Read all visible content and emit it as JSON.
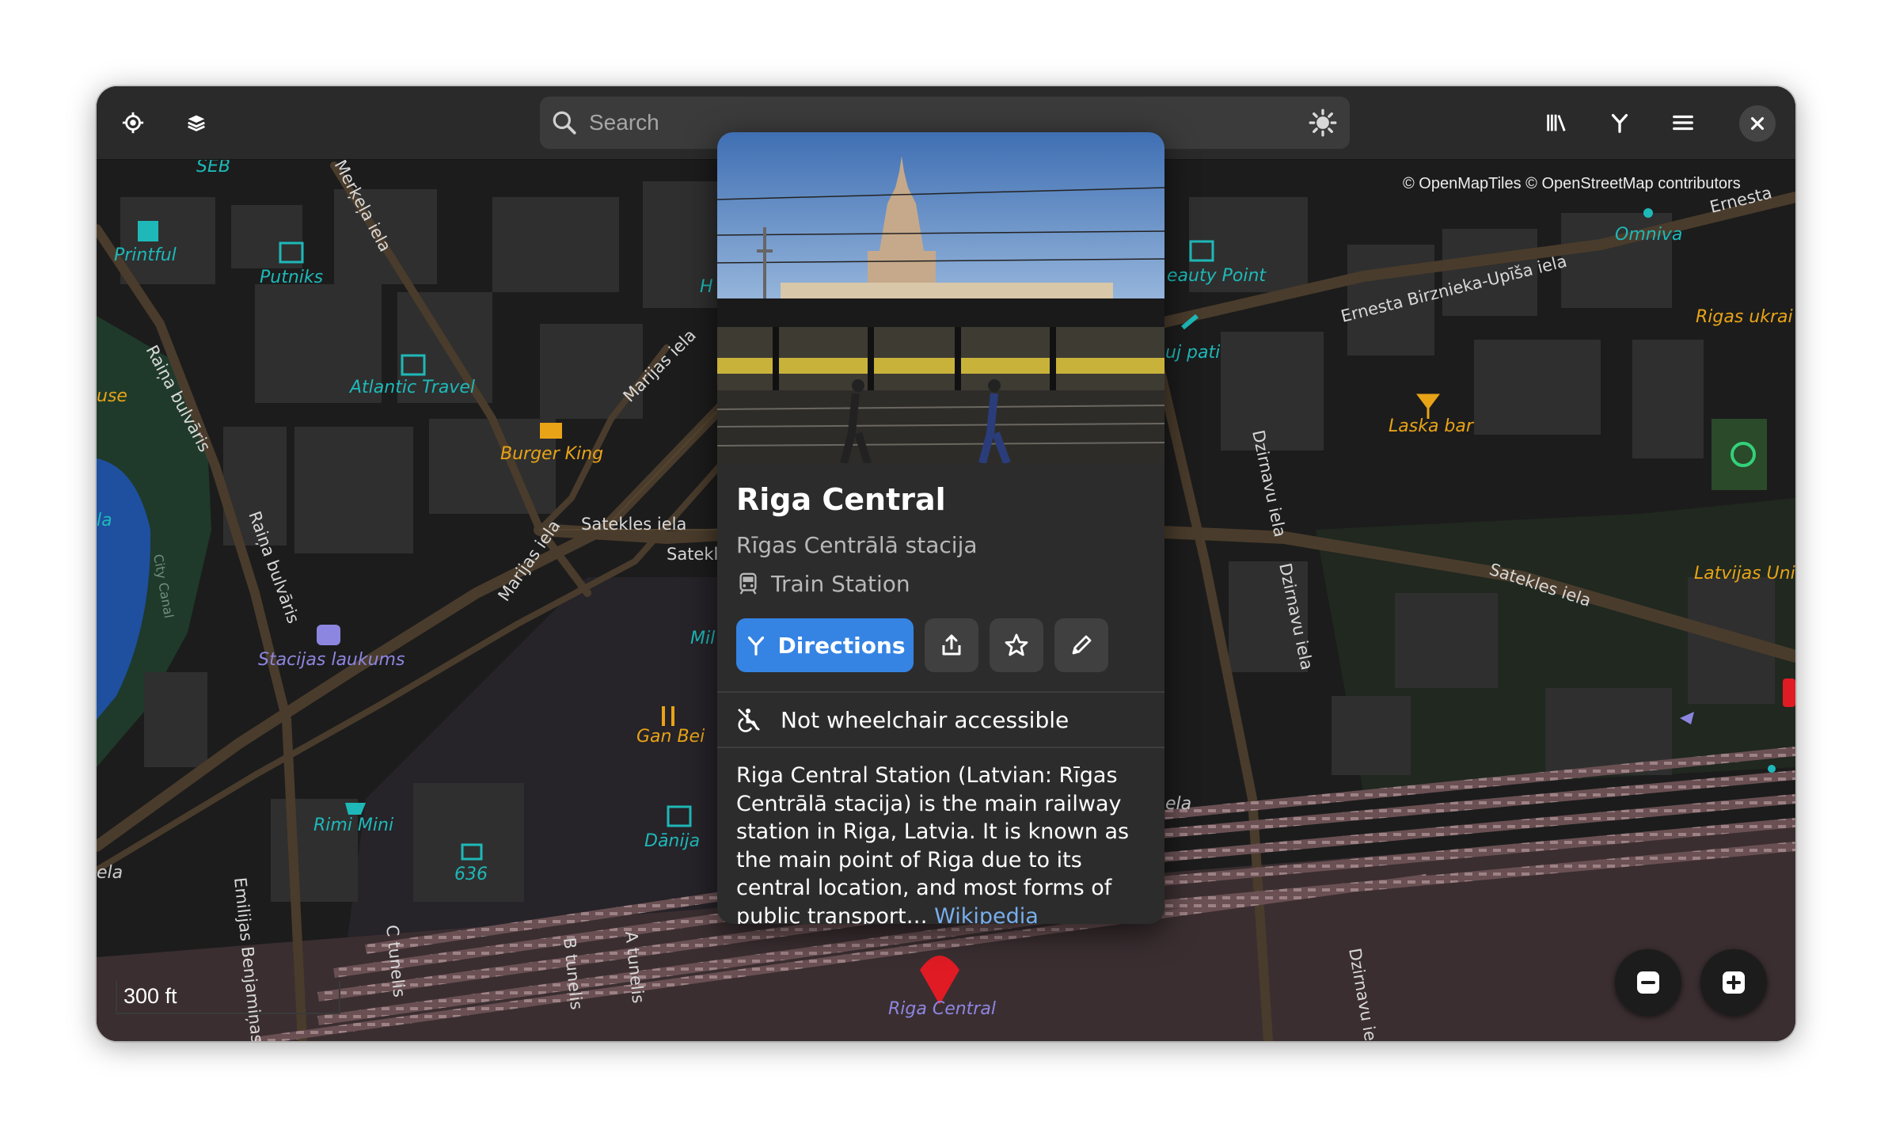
{
  "header": {
    "search_placeholder": "Search",
    "icons": {
      "locate": "crosshair-icon",
      "layers": "layers-icon",
      "search": "search-icon",
      "theme": "sun-icon",
      "library": "library-icon",
      "routing": "route-icon",
      "menu": "hamburger-menu-icon",
      "close": "close-icon"
    }
  },
  "attribution": "© OpenMapTiles © OpenStreetMap contributors",
  "place": {
    "title": "Riga Central",
    "subtitle": "Rīgas Centrālā stacija",
    "type_label": "Train Station",
    "directions_label": "Directions",
    "accessibility": "Not wheelchair accessible",
    "description": "Riga Central Station (Latvian: Rīgas Centrālā stacija) is the main railway station in Riga, Latvia. It is known as the main point of Riga due to its central location, and most forms of public transport… ",
    "link_label": "Wikipedia"
  },
  "map": {
    "scale_label": "300 ft",
    "marker_label": "Riga Central",
    "poi_labels": {
      "seb": "SEB",
      "printful": "Printful",
      "putniks": "Putniks",
      "atlantic": "Atlantic Travel",
      "use": "use",
      "burger": "Burger King",
      "la": "la",
      "stacijas": "Stacijas laukums",
      "rimi": "Rimi Mini",
      "n636": "636",
      "ganbei": "Gan Bei",
      "danija": "Dānija",
      "mil": "Mil",
      "h": "H",
      "beauty": "eauty Point",
      "ujpati": "uj pati",
      "omniva": "Omniva",
      "rigasukr": "Rigas ukrai",
      "laska": "Laska bar",
      "latvijas": "Latvijas Univ",
      "ela_left": "ela",
      "ela_right": "ela"
    },
    "street_labels": {
      "merkela": "Merķeļa iela",
      "raina1": "Raiņa bulvāris",
      "raina2": "Raiņa bulvāris",
      "marijas1": "Marijas iela",
      "marijas2": "Marijas iela",
      "satekles1": "Satekles iela",
      "satekles2": "Satekl",
      "satekles3": "Satekles iela",
      "birznieka": "Ernesta Birznieka-Upīša iela",
      "ernesta": "Ernesta",
      "dzirnavu1": "Dzirnavu iela",
      "dzirnavu2": "Dzirnavu iela",
      "dzirnavu3": "Dzirnavu ie",
      "citycanal": "City Canal",
      "emilijas": "Emilijas Benjamiņas",
      "ctunelis": "C tunelis",
      "btunelis": "B tunelis",
      "atunelis": "A tunelis"
    }
  },
  "zoom": {
    "out_icon": "zoom-out-icon",
    "in_icon": "zoom-in-icon"
  },
  "colors": {
    "accent": "#3584e4",
    "poi_teal": "#1fb8b8",
    "poi_orange": "#e8a317",
    "poi_purple": "#8d86e0",
    "marker": "#e01b24",
    "link": "#78aeed"
  }
}
